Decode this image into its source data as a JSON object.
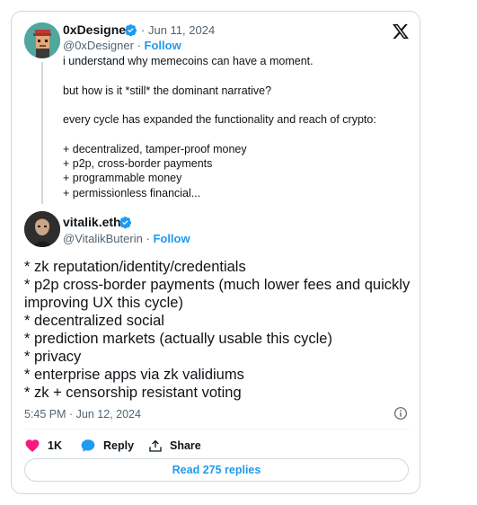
{
  "quoted": {
    "name": "0xDesigner",
    "date": "Jun 11, 2024",
    "handle": "@0xDesigner",
    "separator": "·",
    "follow": "Follow",
    "lines": [
      "i understand why memecoins can have a moment.",
      "",
      "but how is it *still* the dominant narrative?",
      "",
      "every cycle has expanded the functionality and reach of crypto:",
      "",
      "+ decentralized, tamper-proof money",
      "+ p2p, cross-border payments",
      "+ programmable money",
      "+ permissionless financial..."
    ]
  },
  "reply": {
    "name": "vitalik.eth",
    "handle": "@VitalikButerin",
    "separator": "·",
    "follow": "Follow",
    "lines": [
      "* zk reputation/identity/credentials",
      "* p2p cross-border payments (much lower fees and quickly improving UX this cycle)",
      "* decentralized social",
      "* prediction markets (actually usable this cycle)",
      "* privacy",
      "* enterprise apps via zk validiums",
      "* zk + censorship resistant voting"
    ],
    "timestamp": "5:45 PM · Jun 12, 2024"
  },
  "actions": {
    "likes": "1K",
    "reply": "Reply",
    "share": "Share"
  },
  "read_replies": "Read 275 replies",
  "colors": {
    "accent": "#1d9bf0",
    "like": "#f91880",
    "muted": "#536471",
    "border": "#cfd9de"
  },
  "icons": [
    "x-logo-icon",
    "verified-badge-icon",
    "info-icon",
    "heart-icon",
    "reply-bubble-icon",
    "share-icon"
  ]
}
